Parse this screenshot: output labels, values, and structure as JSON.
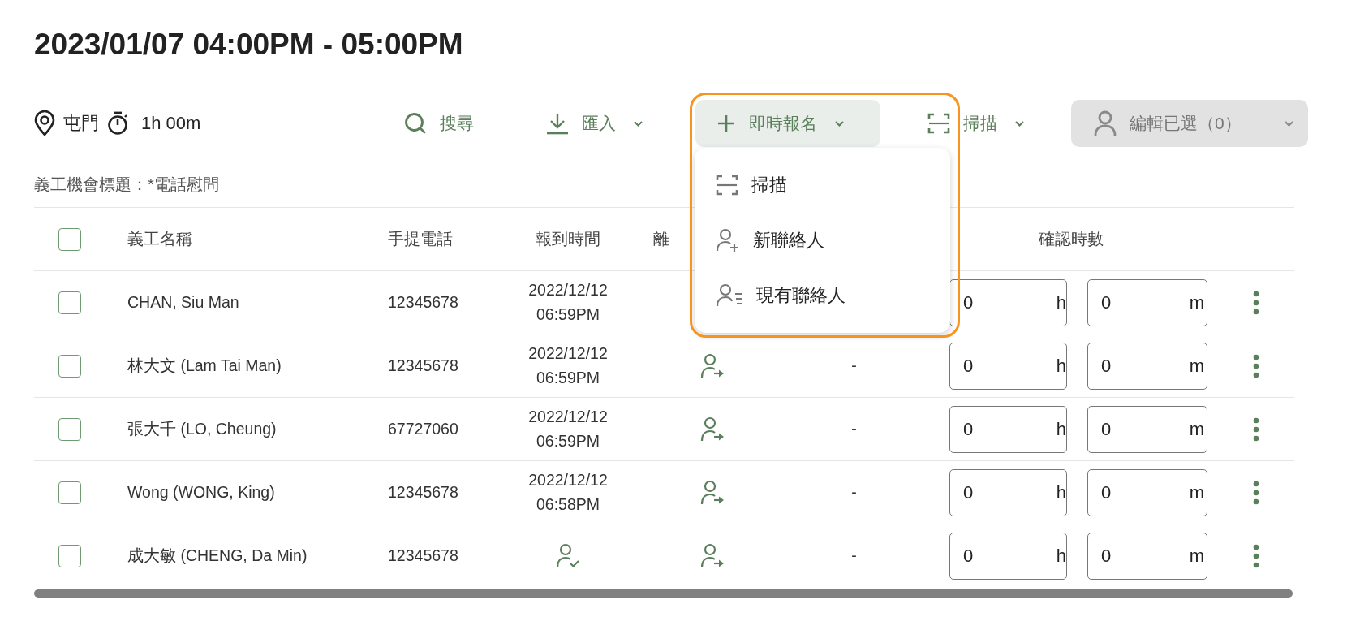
{
  "title": "2023/01/07 04:00PM - 05:00PM",
  "info": {
    "location": "屯門",
    "duration": "1h 00m"
  },
  "toolbar": [
    {
      "kind": "search",
      "label": "搜尋",
      "caret": false,
      "disabled": false,
      "expanded": false
    },
    {
      "kind": "import",
      "label": "匯入",
      "caret": true,
      "disabled": false,
      "expanded": false
    },
    {
      "kind": "add",
      "label": "即時報名",
      "caret": true,
      "disabled": false,
      "expanded": true,
      "menu": [
        {
          "kind": "scan",
          "label": "掃描"
        },
        {
          "kind": "new-contact",
          "label": "新聯絡人"
        },
        {
          "kind": "existing-contact",
          "label": "現有聯絡人"
        }
      ]
    },
    {
      "kind": "scan",
      "label": "掃描",
      "caret": true,
      "disabled": false,
      "expanded": false
    },
    {
      "kind": "person",
      "label": "編輯已選（0）",
      "caret": true,
      "disabled": true,
      "expanded": false
    }
  ],
  "subtitle": "義工機會標題：*電話慰問",
  "table": {
    "select_all": {
      "checked": false
    },
    "columns": [
      "義工名稱",
      "手提電話",
      "報到時間",
      "離",
      "確認時數"
    ],
    "rows": [
      {
        "checked": false,
        "name": "CHAN, Siu Man",
        "phone": "12345678",
        "check_in": {
          "kind": "time",
          "date": "2022/12/12",
          "time": "06:59PM"
        },
        "hours": {
          "value": "0",
          "unit": "h"
        },
        "minutes": {
          "value": "0",
          "unit": "m"
        }
      },
      {
        "checked": false,
        "name": "林大文 (Lam Tai Man)",
        "phone": "12345678",
        "check_in": {
          "kind": "time",
          "date": "2022/12/12",
          "time": "06:59PM"
        },
        "check_out": {
          "kind": "button"
        },
        "column_5": "-",
        "hours": {
          "value": "0",
          "unit": "h"
        },
        "minutes": {
          "value": "0",
          "unit": "m"
        }
      },
      {
        "checked": false,
        "name": "張大千 (LO, Cheung)",
        "phone": "67727060",
        "check_in": {
          "kind": "time",
          "date": "2022/12/12",
          "time": "06:59PM"
        },
        "check_out": {
          "kind": "button"
        },
        "column_5": "-",
        "hours": {
          "value": "0",
          "unit": "h"
        },
        "minutes": {
          "value": "0",
          "unit": "m"
        }
      },
      {
        "checked": false,
        "name": "Wong (WONG, King)",
        "phone": "12345678",
        "check_in": {
          "kind": "time",
          "date": "2022/12/12",
          "time": "06:58PM"
        },
        "check_out": {
          "kind": "button"
        },
        "column_5": "-",
        "hours": {
          "value": "0",
          "unit": "h"
        },
        "minutes": {
          "value": "0",
          "unit": "m"
        }
      },
      {
        "checked": false,
        "name": "成大敏 (CHENG, Da Min)",
        "phone": "12345678",
        "check_in": {
          "kind": "button"
        },
        "check_out": {
          "kind": "button"
        },
        "column_5": "-",
        "hours": {
          "value": "0",
          "unit": "h"
        },
        "minutes": {
          "value": "0",
          "unit": "m"
        }
      }
    ]
  }
}
